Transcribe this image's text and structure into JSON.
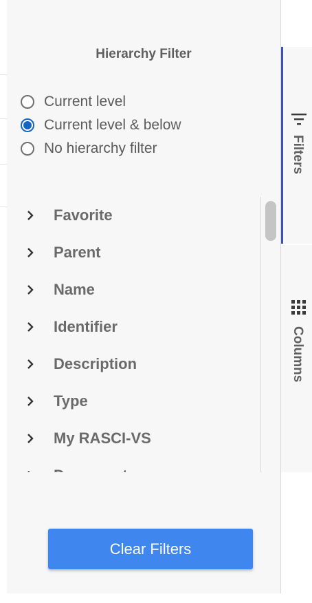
{
  "panel": {
    "title": "Hierarchy Filter",
    "radio_options": [
      {
        "label": "Current level",
        "checked": false
      },
      {
        "label": "Current level & below",
        "checked": true
      },
      {
        "label": "No hierarchy filter",
        "checked": false
      }
    ],
    "filter_columns": [
      "Favorite",
      "Parent",
      "Name",
      "Identifier",
      "Description",
      "Type",
      "My RASCI-VS",
      "Documents"
    ],
    "clear_button_label": "Clear Filters"
  },
  "side_tabs": {
    "filters": {
      "label": "Filters",
      "icon": "filter-lines-icon",
      "active": true
    },
    "columns": {
      "label": "Columns",
      "icon": "grid-icon",
      "active": false
    }
  },
  "colors": {
    "accent": "#1565c0",
    "button": "#3f87ee",
    "active_tab_border": "#3f51b5"
  }
}
